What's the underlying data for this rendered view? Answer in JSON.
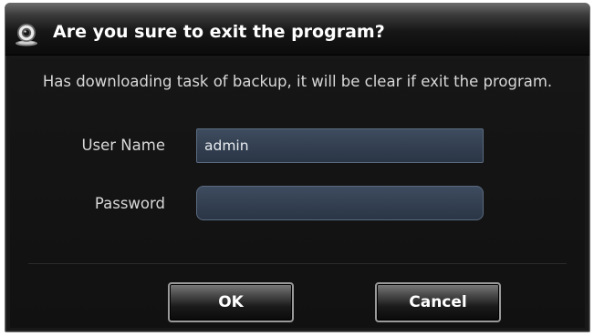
{
  "dialog": {
    "title": "Are you sure to exit the program?",
    "app_icon": "webcam-icon",
    "message": "Has downloading task of backup, it will be clear if exit the program.",
    "fields": {
      "username_label": "User Name",
      "username_value": "admin",
      "password_label": "Password",
      "password_value": ""
    },
    "buttons": {
      "ok_label": "OK",
      "cancel_label": "Cancel"
    }
  },
  "colors": {
    "dialog_background": "#181818",
    "input_background": "#33404f",
    "text": "#d8d8d8"
  }
}
